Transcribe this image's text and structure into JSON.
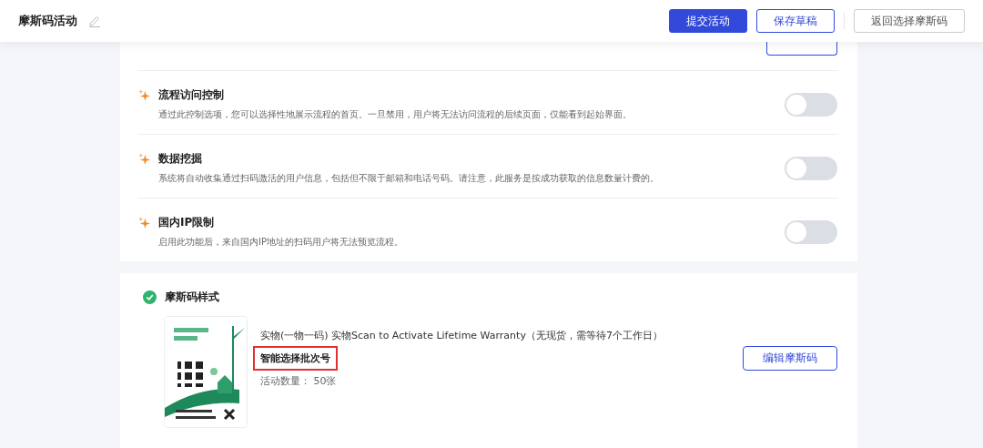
{
  "header": {
    "title": "摩斯码活动",
    "buttons": [
      {
        "label": "提交活动",
        "kind": "primary"
      },
      {
        "label": "保存草稿",
        "kind": "outline"
      },
      {
        "label": "返回选择摩斯码",
        "kind": "plain"
      }
    ]
  },
  "settings": [
    {
      "title": "流程访问控制",
      "description": "通过此控制选项，您可以选择性地展示流程的首页。一旦禁用，用户将无法访问流程的后续页面，仅能看到起始界面。",
      "on": false
    },
    {
      "title": "数据挖掘",
      "description": "系统将自动收集通过扫码激活的用户信息，包括但不限于邮箱和电话号码。请注意，此服务是按成功获取的信息数量计费的。",
      "on": false
    },
    {
      "title": "国内IP限制",
      "description": "启用此功能后，来自国内IP地址的扫码用户将无法预览流程。",
      "on": false
    }
  ],
  "code_style": {
    "title": "摩斯码样式",
    "done": true,
    "name": "实物(一物一码) 实物Scan to Activate Lifetime Warranty（无现货，需等待7个工作日）",
    "batch": {
      "label": "智能选择批次号",
      "highlighted": true
    },
    "quantity_label": "活动数量：",
    "quantity": "50张",
    "edit_button": "编辑摩斯码"
  }
}
